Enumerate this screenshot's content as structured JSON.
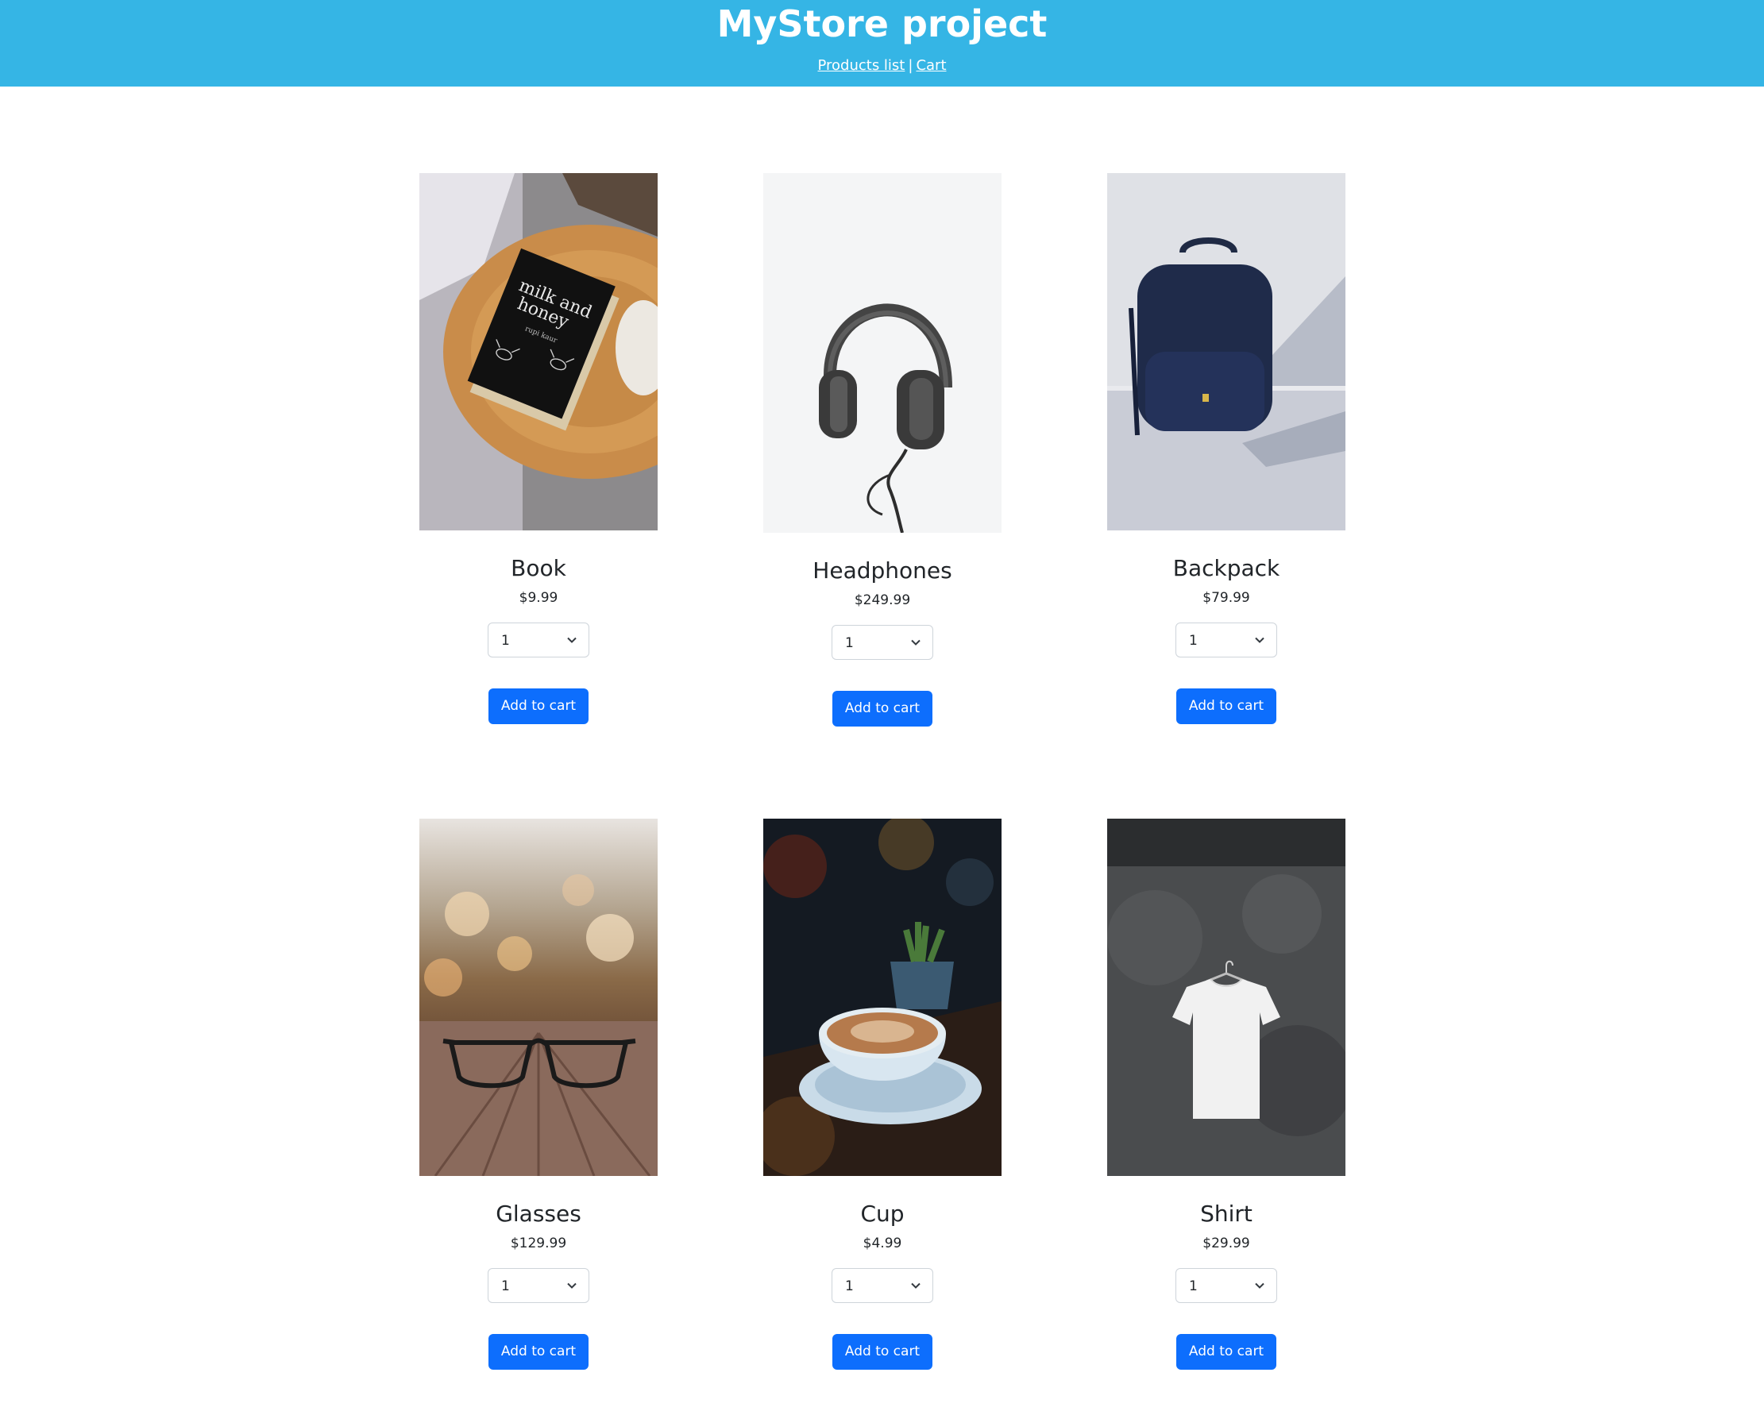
{
  "header": {
    "title": "MyStore project",
    "nav": {
      "products_label": "Products list",
      "separator": "|",
      "cart_label": "Cart"
    }
  },
  "products": [
    {
      "name": "Book",
      "price": "$9.99",
      "quantity": "1",
      "button": "Add to cart",
      "image": "book-image"
    },
    {
      "name": "Headphones",
      "price": "$249.99",
      "quantity": "1",
      "button": "Add to cart",
      "image": "headphones-image"
    },
    {
      "name": "Backpack",
      "price": "$79.99",
      "quantity": "1",
      "button": "Add to cart",
      "image": "backpack-image"
    },
    {
      "name": "Glasses",
      "price": "$129.99",
      "quantity": "1",
      "button": "Add to cart",
      "image": "glasses-image"
    },
    {
      "name": "Cup",
      "price": "$4.99",
      "quantity": "1",
      "button": "Add to cart",
      "image": "cup-image"
    },
    {
      "name": "Shirt",
      "price": "$29.99",
      "quantity": "1",
      "button": "Add to cart",
      "image": "shirt-image"
    }
  ],
  "book_cover": {
    "title_line1": "milk and",
    "title_line2": "honey",
    "author": "rupi kaur"
  },
  "colors": {
    "header_bg": "#35b5e5",
    "button_bg": "#0d6efd"
  }
}
